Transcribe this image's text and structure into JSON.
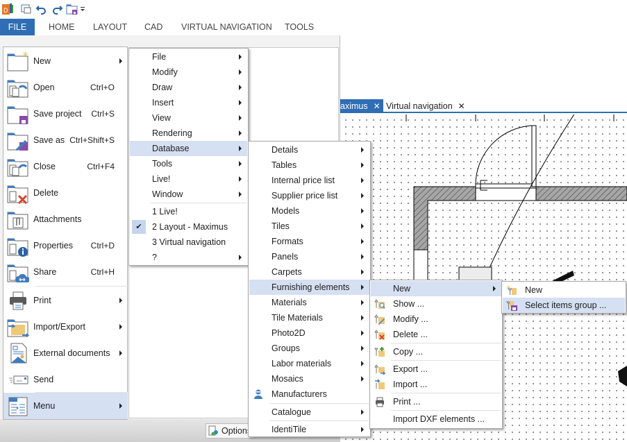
{
  "quick_access": {
    "icons": [
      "app-logo-icon",
      "window-icon",
      "undo-icon",
      "redo-icon",
      "save-folder-icon",
      "customize-dropdown-icon"
    ]
  },
  "ribbon": {
    "tabs": [
      {
        "label": "FILE",
        "active": true
      },
      {
        "label": "HOME"
      },
      {
        "label": "LAYOUT"
      },
      {
        "label": "CAD"
      },
      {
        "label": "VIRTUAL NAVIGATION"
      },
      {
        "label": "TOOLS"
      }
    ]
  },
  "file_menu": {
    "items": [
      {
        "label": "New",
        "shortcut": "",
        "submenu": true,
        "icon": "new-folder-icon"
      },
      {
        "label": "Open",
        "shortcut": "Ctrl+O",
        "icon": "open-folder-icon"
      },
      {
        "label": "Save project",
        "shortcut": "Ctrl+S",
        "icon": "save-project-icon"
      },
      {
        "label": "Save as",
        "shortcut": "Ctrl+Shift+S",
        "icon": "save-as-icon"
      },
      {
        "label": "Close",
        "shortcut": "Ctrl+F4",
        "icon": "close-folder-icon"
      },
      {
        "label": "Delete",
        "shortcut": "",
        "icon": "delete-folder-icon"
      },
      {
        "label": "Attachments",
        "shortcut": "",
        "icon": "attachments-icon"
      },
      {
        "label": "Properties",
        "shortcut": "Ctrl+D",
        "icon": "properties-icon"
      },
      {
        "label": "Share",
        "shortcut": "Ctrl+H",
        "icon": "share-icon"
      },
      {
        "label": "Print",
        "shortcut": "",
        "submenu": true,
        "icon": "printer-icon"
      },
      {
        "label": "Import/Export",
        "shortcut": "",
        "submenu": true,
        "icon": "import-export-icon"
      },
      {
        "label": "External documents",
        "shortcut": "",
        "submenu": true,
        "icon": "external-documents-icon"
      },
      {
        "label": "Send",
        "shortcut": "",
        "icon": "send-icon"
      },
      {
        "label": "Menu",
        "shortcut": "",
        "submenu": true,
        "active": true,
        "icon": "menu-icon"
      }
    ]
  },
  "menu_submenu": {
    "items": [
      {
        "label": "File",
        "submenu": true
      },
      {
        "label": "Modify",
        "submenu": true
      },
      {
        "label": "Draw",
        "submenu": true
      },
      {
        "label": "Insert",
        "submenu": true
      },
      {
        "label": "View",
        "submenu": true
      },
      {
        "label": "Rendering",
        "submenu": true
      },
      {
        "label": "Database",
        "submenu": true,
        "active": true
      },
      {
        "label": "Tools",
        "submenu": true
      },
      {
        "label": "Live!",
        "submenu": true
      },
      {
        "label": "Window",
        "submenu": true
      }
    ],
    "windows": [
      {
        "label": "1 Live!"
      },
      {
        "label": "2 Layout - Maximus",
        "checked": true
      },
      {
        "label": "3 Virtual navigation"
      },
      {
        "label": "?",
        "submenu": true
      }
    ]
  },
  "database_submenu": {
    "items": [
      {
        "label": "Details",
        "submenu": true
      },
      {
        "label": "Tables",
        "submenu": true
      },
      {
        "label": "Internal price list",
        "submenu": true
      },
      {
        "label": "Supplier price list",
        "submenu": true
      },
      {
        "label": "Models",
        "submenu": true
      },
      {
        "label": "Tiles",
        "submenu": true
      },
      {
        "label": "Formats",
        "submenu": true
      },
      {
        "label": "Panels",
        "submenu": true
      },
      {
        "label": "Carpets",
        "submenu": true
      },
      {
        "label": "Furnishing elements",
        "submenu": true,
        "active": true
      },
      {
        "label": "Materials",
        "submenu": true
      },
      {
        "label": "Tile Materials",
        "submenu": true
      },
      {
        "label": "Photo2D",
        "submenu": true
      },
      {
        "label": "Groups",
        "submenu": true
      },
      {
        "label": "Labor materials",
        "submenu": true
      },
      {
        "label": "Mosaics",
        "submenu": true
      },
      {
        "label": "Manufacturers",
        "icon": "user-icon"
      },
      {
        "label": "Catalogue",
        "submenu": true
      },
      {
        "label": "IdentiTile",
        "submenu": true
      }
    ]
  },
  "furnishing_submenu": {
    "items": [
      {
        "label": "New",
        "submenu": true,
        "active": true
      },
      {
        "label": "Show ...",
        "icon": "show-icon"
      },
      {
        "label": "Modify ...",
        "icon": "modify-icon"
      },
      {
        "label": "Delete ...",
        "icon": "delete-icon"
      },
      {
        "label": "Copy ...",
        "icon": "copy-icon"
      },
      {
        "label": "Export ...",
        "icon": "export-icon"
      },
      {
        "label": "Import ...",
        "icon": "import-icon"
      },
      {
        "label": "Print ...",
        "icon": "print-icon"
      },
      {
        "label": "Import DXF elements ..."
      }
    ]
  },
  "new_submenu": {
    "items": [
      {
        "label": "New",
        "icon": "new-item-icon"
      },
      {
        "label": "Select items group ...",
        "icon": "select-group-icon",
        "active": true
      }
    ]
  },
  "backstage": {
    "options_label": "Options"
  },
  "document_tabs": [
    {
      "label": "aximus",
      "active": true
    },
    {
      "label": "Virtual navigation"
    }
  ],
  "colors": {
    "accent": "#2f6db5",
    "menu_highlight": "#d5e0f2",
    "wall_hatch": "#a6a6a6"
  }
}
